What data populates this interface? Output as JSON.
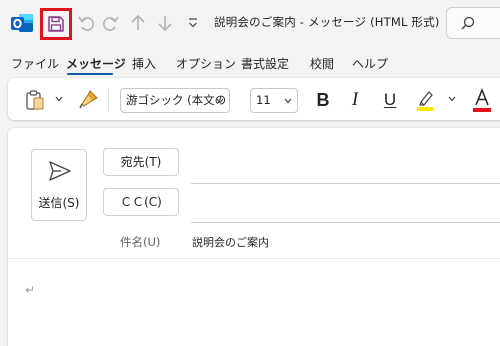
{
  "window": {
    "title": "説明会のご案内  -  メッセージ (HTML 形式)"
  },
  "quick_access": {
    "app_icon": "outlook-icon",
    "save_icon": "save-icon",
    "undo_icon": "undo-icon",
    "redo_icon": "redo-icon",
    "up_icon": "arrow-up-icon",
    "down_icon": "arrow-down-icon",
    "more_icon": "customize-qat-icon",
    "highlight_color": "#e3131c"
  },
  "search": {
    "icon": "search-icon"
  },
  "menu": {
    "tabs": [
      {
        "label": "ファイル"
      },
      {
        "label": "メッセージ"
      },
      {
        "label": "挿入"
      },
      {
        "label": "オプション"
      },
      {
        "label": "書式設定"
      },
      {
        "label": "校閲"
      },
      {
        "label": "ヘルプ"
      }
    ],
    "active_tab": "メッセージ",
    "accent_color": "#115ea3"
  },
  "ribbon": {
    "font_name": "游ゴシック (本文の",
    "font_size": "11",
    "bold": "B",
    "italic": "I",
    "underline": "U",
    "font_color_letter": "A",
    "highlight_color": "#ffe600",
    "font_color": "#e3131c"
  },
  "compose": {
    "send_label": "送信(S)",
    "to_label": "宛先(T)",
    "cc_label": "ＣＣ(C)",
    "subject_label": "件名(U)",
    "subject_value": "説明会のご案内",
    "body_mark": "↵"
  }
}
